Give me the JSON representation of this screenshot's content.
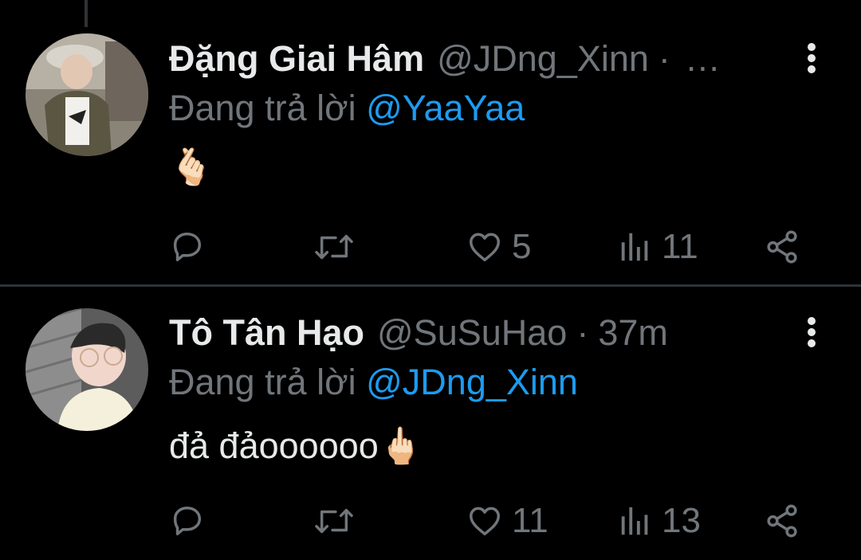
{
  "tweets": [
    {
      "display_name": "Đặng Giai Hâm",
      "handle": "@JDng_Xinn",
      "dot": "·",
      "time": "…",
      "reply_prefix": "Đang trả lời",
      "reply_to": "@YaaYaa",
      "body": "",
      "body_emoji": "🫰🏻",
      "replies": "",
      "retweets": "",
      "likes": "5",
      "views": "11"
    },
    {
      "display_name": "Tô Tân Hạo",
      "handle": "@SuSuHao",
      "dot": "·",
      "time": "37m",
      "reply_prefix": "Đang trả lời",
      "reply_to": "@JDng_Xinn",
      "body": "đả đảoooooo",
      "body_emoji": "🖕🏻",
      "replies": "",
      "retweets": "",
      "likes": "11",
      "views": "13"
    }
  ],
  "icons": {
    "reply": "reply-icon",
    "retweet": "retweet-icon",
    "like": "heart-icon",
    "views": "views-icon",
    "share": "share-icon",
    "more": "more-vertical-icon"
  },
  "colors": {
    "background": "#000000",
    "text": "#e7e9ea",
    "muted": "#71767b",
    "mention": "#1d9bf0",
    "divider": "#2f3336"
  }
}
